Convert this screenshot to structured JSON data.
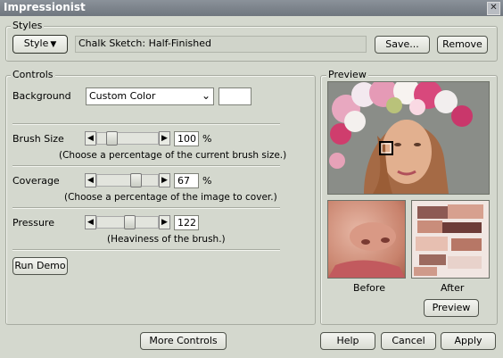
{
  "window": {
    "title": "Impressionist",
    "close_glyph": "✕"
  },
  "styles": {
    "group_label": "Styles",
    "style_button": "Style",
    "style_caret": "▼",
    "current_style": "Chalk Sketch: Half-Finished",
    "save_button": "Save...",
    "remove_button": "Remove"
  },
  "controls": {
    "group_label": "Controls",
    "background": {
      "label": "Background",
      "selected": "Custom Color",
      "swatch_color": "#ffffff"
    },
    "brush_size": {
      "label": "Brush Size",
      "value": "100",
      "unit": "%",
      "hint": "(Choose a percentage of the current brush size.)",
      "level": 0.18
    },
    "coverage": {
      "label": "Coverage",
      "value": "67",
      "unit": "%",
      "hint": "(Choose a percentage of the image to cover.)",
      "level": 0.67
    },
    "pressure": {
      "label": "Pressure",
      "value": "122",
      "unit": "",
      "hint": "(Heaviness of the brush.)",
      "level": 0.55
    },
    "run_demo_button": "Run Demo",
    "left_arrow": "◀",
    "right_arrow": "▶"
  },
  "preview": {
    "group_label": "Preview",
    "before_label": "Before",
    "after_label": "After",
    "preview_button": "Preview"
  },
  "footer": {
    "more_controls_button": "More Controls",
    "help_button": "Help",
    "cancel_button": "Cancel",
    "apply_button": "Apply"
  }
}
